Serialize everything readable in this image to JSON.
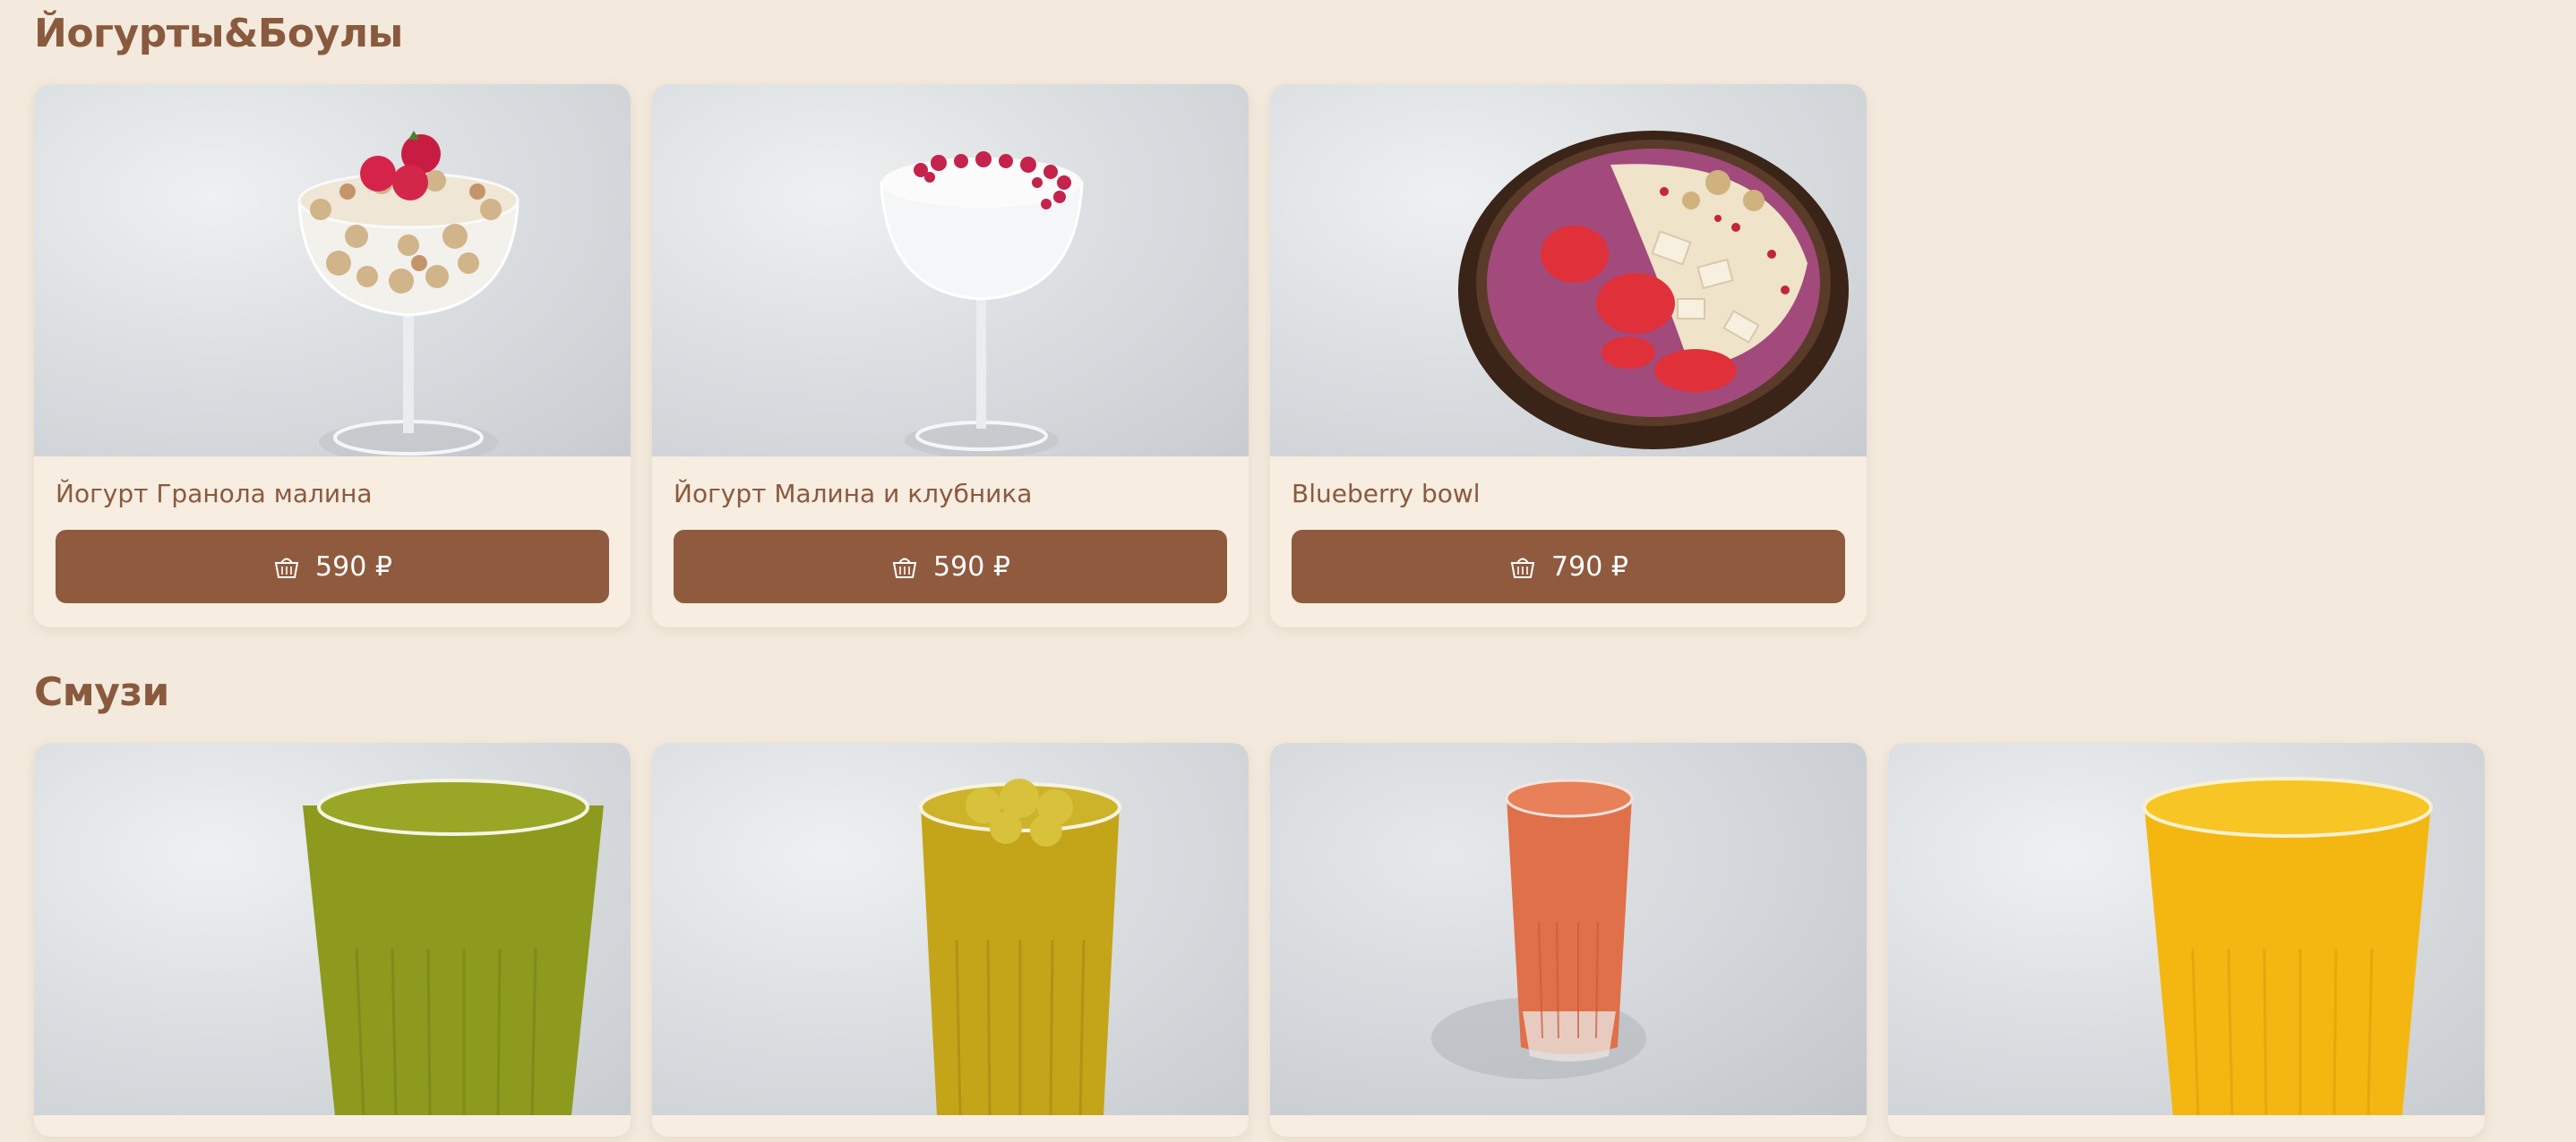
{
  "sections": [
    {
      "title": "Йогурты&Боулы",
      "items": [
        {
          "name": "Йогурт Гранола малина",
          "price": "590 ₽"
        },
        {
          "name": "Йогурт Малина и клубника",
          "price": "590 ₽"
        },
        {
          "name": "Blueberry bowl",
          "price": "790 ₽"
        }
      ]
    },
    {
      "title": "Смузи",
      "items": [
        {
          "name": ""
        },
        {
          "name": ""
        },
        {
          "name": ""
        },
        {
          "name": ""
        }
      ]
    }
  ],
  "icons": {
    "price_button": "basket-icon"
  },
  "colors": {
    "background": "#f3eadd",
    "accent": "#8f5a3e",
    "text": "#8a5a3e"
  }
}
